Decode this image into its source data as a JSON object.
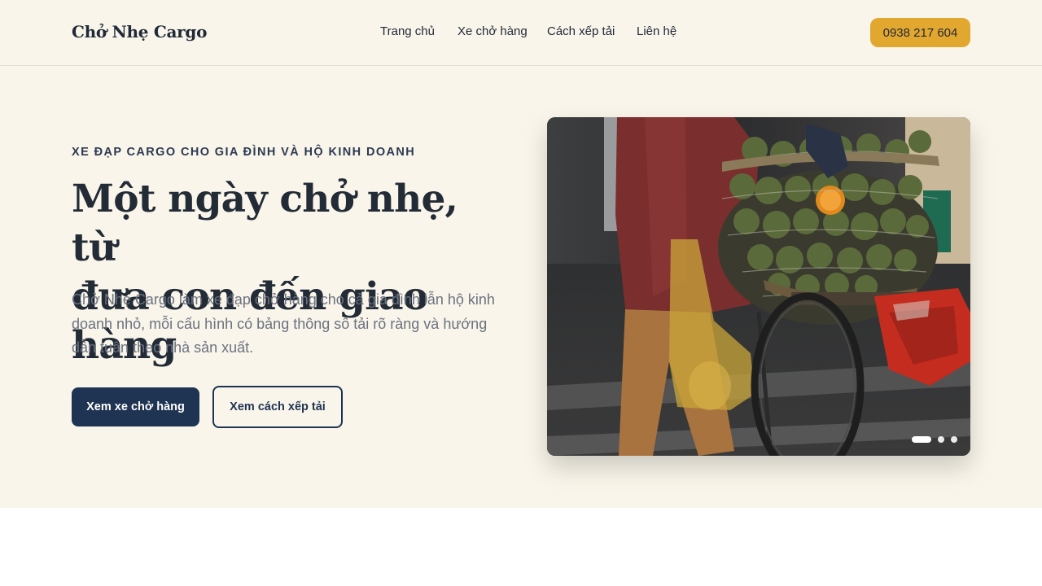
{
  "header": {
    "brand": "Chở Nhẹ Cargo",
    "nav": [
      "Trang chủ",
      "Xe chở hàng",
      "Cách xếp tải",
      "Liên hệ"
    ],
    "phone": "0938 217 604"
  },
  "hero": {
    "eyebrow": "XE ĐẠP CARGO CHO GIA ĐÌNH VÀ HỘ KINH DOANH",
    "title_line1": "Một ngày chở nhẹ, từ",
    "title_line2": "đưa con đến giao hàng",
    "description": "Chở Nhẹ Cargo làm xe đạp chở hàng cho cả gia đình lẫn hộ kinh doanh nhỏ, mỗi cấu hình có bảng thông số tải rõ ràng và hướng dẫn tuân theo nhà sản xuất.",
    "primary_button": "Xem xe chở hàng",
    "secondary_button": "Xem cách xếp tải"
  },
  "carousel": {
    "slide_count": 3,
    "active_index": 0
  },
  "colors": {
    "background": "#f9f5ea",
    "primary": "#1f3352",
    "accent": "#e2a72e"
  }
}
